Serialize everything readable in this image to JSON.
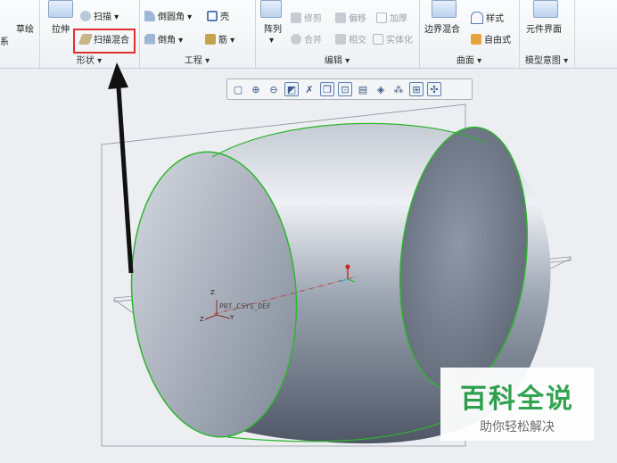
{
  "ribbon": {
    "left_edge": {
      "sketch_label": "草绘",
      "cut_char": "系"
    },
    "shape": {
      "extrude_label": "拉伸",
      "sweep_label": "扫描 ▾",
      "swept_blend_label": "扫描混合",
      "group_label": "形状 ▾"
    },
    "engineering": {
      "round_label": "倒圆角 ▾",
      "shell_label": "壳",
      "chamfer_label": "倒角 ▾",
      "rib_label": "筋 ▾",
      "group_label": "工程 ▾"
    },
    "editing": {
      "pattern_label": "阵列",
      "trim_label": "修剪",
      "offset_label": "偏移",
      "thicken_label": "加厚",
      "merge_label": "合并",
      "intersect_label": "相交",
      "solidify_label": "实体化",
      "group_label": "编辑 ▾"
    },
    "surfaces": {
      "boundary_blend_label": "边界混合",
      "style_label": "样式",
      "freestyle_label": "自由式",
      "group_label": "曲面 ▾"
    },
    "model_intent": {
      "component_interface_label": "元件界面",
      "group_label": "模型意图 ▾"
    }
  },
  "viewport": {
    "csys_label": "PRT_CSYS_DEF",
    "axis_z": "Z",
    "axis_y": "Y",
    "axis_z2": "Z"
  },
  "watermark": {
    "title": "百科全说",
    "subtitle": "助你轻松解决"
  },
  "colors": {
    "highlight": "#e0302b",
    "edge_green": "#2fb52f",
    "body_gray": "#8c95a3",
    "watermark_green": "#2aa14a"
  }
}
